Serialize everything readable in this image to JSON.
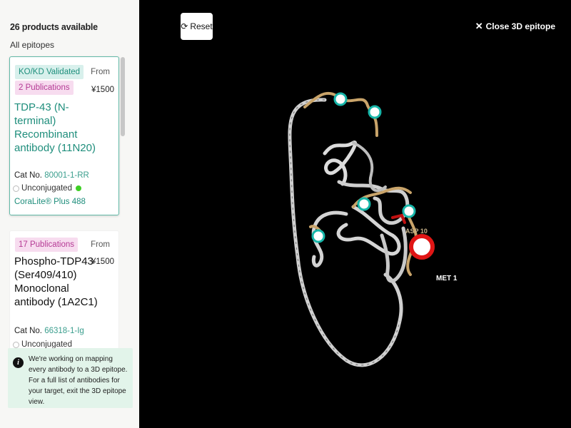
{
  "sidebar": {
    "results_count": "26 products available",
    "filter_label": "All epitopes",
    "products": [
      {
        "badges": [
          "KO/KD Validated",
          "2 Publications"
        ],
        "price_from": "From",
        "price": "¥1500",
        "name": "TDP-43 (N-terminal) Recombinant antibody (11N20)",
        "cat_label": "Cat No.",
        "cat_no": "80001-1-RR",
        "conjugate": "Unconjugated",
        "conjugate_alt": "CoraLite® Plus 488"
      },
      {
        "badges": [
          "17 Publications"
        ],
        "price_from": "From",
        "price": "¥1500",
        "name": "Phospho-TDP43 (Ser409/410) Monoclonal antibody (1A2C1)",
        "cat_label": "Cat No.",
        "cat_no": "66318-1-Ig",
        "conjugate": "Unconjugated"
      }
    ],
    "info_icon": "info-icon",
    "info_text": "We're working on mapping every antibody to a 3D epitope. For a full list of antibodies for your target, exit the 3D epitope view."
  },
  "viewer": {
    "reset_label": "Reset",
    "reset_icon": "refresh-icon",
    "close_label": "Close 3D epitope",
    "close_icon": "close-x-icon",
    "residue_labels": {
      "partial": "ASP 10",
      "met": "MET 1"
    },
    "colors": {
      "background": "#000000",
      "chain": "#d0d0d0",
      "epitope_segment": "#c9a46a",
      "epitope_marker": "#16b5a8",
      "selected_marker": "#e01515",
      "kokd_badge": "#d8f0ec",
      "pub_badge": "#f7dcef",
      "info_box": "#e2f4ea"
    }
  }
}
